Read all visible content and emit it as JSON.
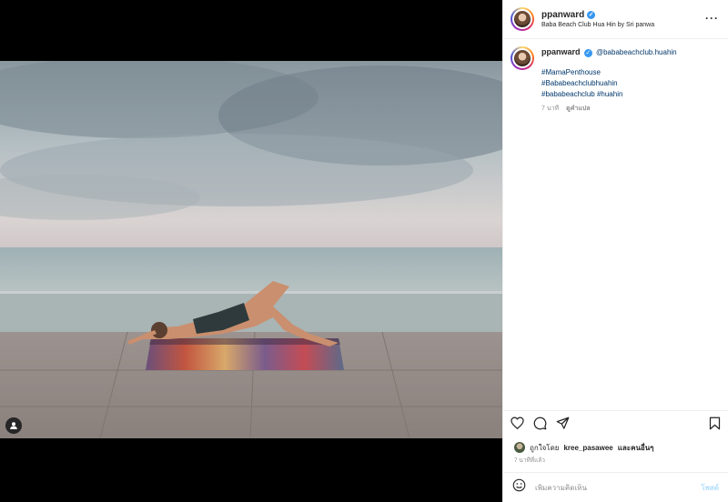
{
  "post": {
    "username": "ppanward",
    "location": "Baba Beach Club Hua Hin by Sri panwa",
    "more_icon": "more-horizontal-icon",
    "caption_username": "ppanward",
    "mention": "@bababeachclub.huahin",
    "hashtag_line1": "#MamaPenthouse",
    "hashtag_line2": "#Bababeachclubhuahin",
    "hashtag_line3": "#bababeachclub #huahin",
    "time_ago": "7 นาที",
    "translate_label": "ดูคำแปล",
    "liked_by_prefix": "ถูกใจโดย",
    "liked_by_user": "kree_pasawee",
    "liked_by_suffix": "และคนอื่นๆ",
    "post_time": "7 นาทีที่แล้ว"
  },
  "comment_box": {
    "placeholder": "เพิ่มความคิดเห็น",
    "post_label": "โพสต์"
  },
  "icons": {
    "verified": "verified-badge-icon",
    "like": "heart-icon",
    "comment": "comment-icon",
    "share": "send-icon",
    "save": "bookmark-icon",
    "emoji": "emoji-icon",
    "tag": "user-tag-icon"
  },
  "colors": {
    "link": "#00376b",
    "verified": "#3897f0",
    "muted": "#8e8e8e"
  }
}
